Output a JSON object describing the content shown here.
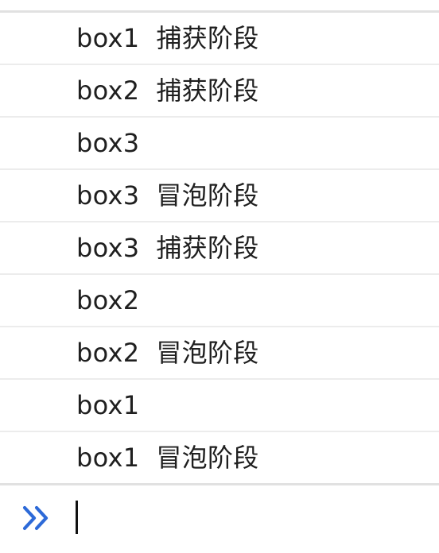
{
  "console": {
    "logs": [
      {
        "text": "box1  捕获阶段"
      },
      {
        "text": "box2  捕获阶段"
      },
      {
        "text": "box3"
      },
      {
        "text": "box3  冒泡阶段"
      },
      {
        "text": "box3  捕获阶段"
      },
      {
        "text": "box2"
      },
      {
        "text": "box2  冒泡阶段"
      },
      {
        "text": "box1"
      },
      {
        "text": "box1  冒泡阶段"
      }
    ],
    "prompt": {
      "icon": "chevron-double-right-icon",
      "icon_color": "#2d6ad8",
      "input_value": ""
    }
  }
}
